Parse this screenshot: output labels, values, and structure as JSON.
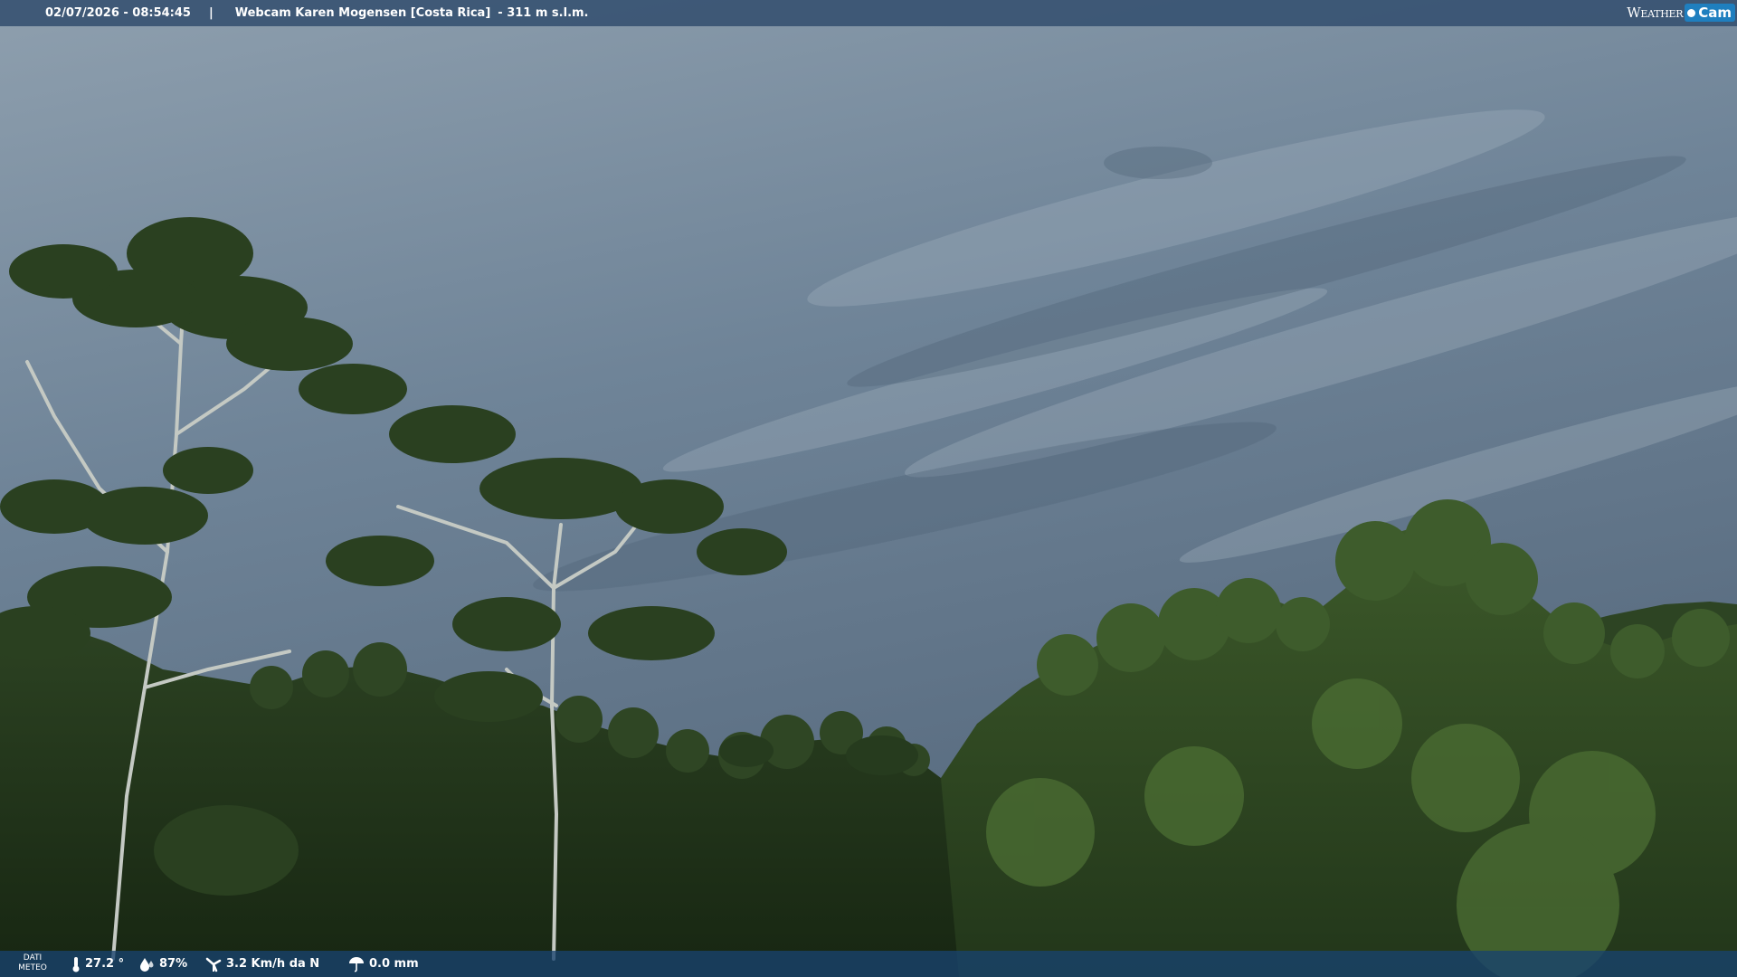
{
  "header": {
    "datetime": "02/07/2026 - 08:54:45",
    "separator": "|",
    "location": "Webcam Karen Mogensen [Costa Rica]",
    "elevation": "- 311 m s.l.m."
  },
  "logo": {
    "weather": "Weather",
    "cam": "Cam"
  },
  "weather_bar": {
    "badge_line1": "DATI",
    "badge_line2": "METEO",
    "temperature": "27.2 °",
    "humidity": "87%",
    "wind": "3.2 Km/h da N",
    "rain": "0.0 mm"
  },
  "colors": {
    "top_bar": "#345070",
    "bottom_bar": "#18426e",
    "sky": "#6f8498",
    "forest": "#24351c",
    "logo_accent": "#1f7fbf"
  },
  "icons": [
    "thermometer-icon",
    "humidity-icon",
    "wind-icon",
    "rain-icon"
  ]
}
